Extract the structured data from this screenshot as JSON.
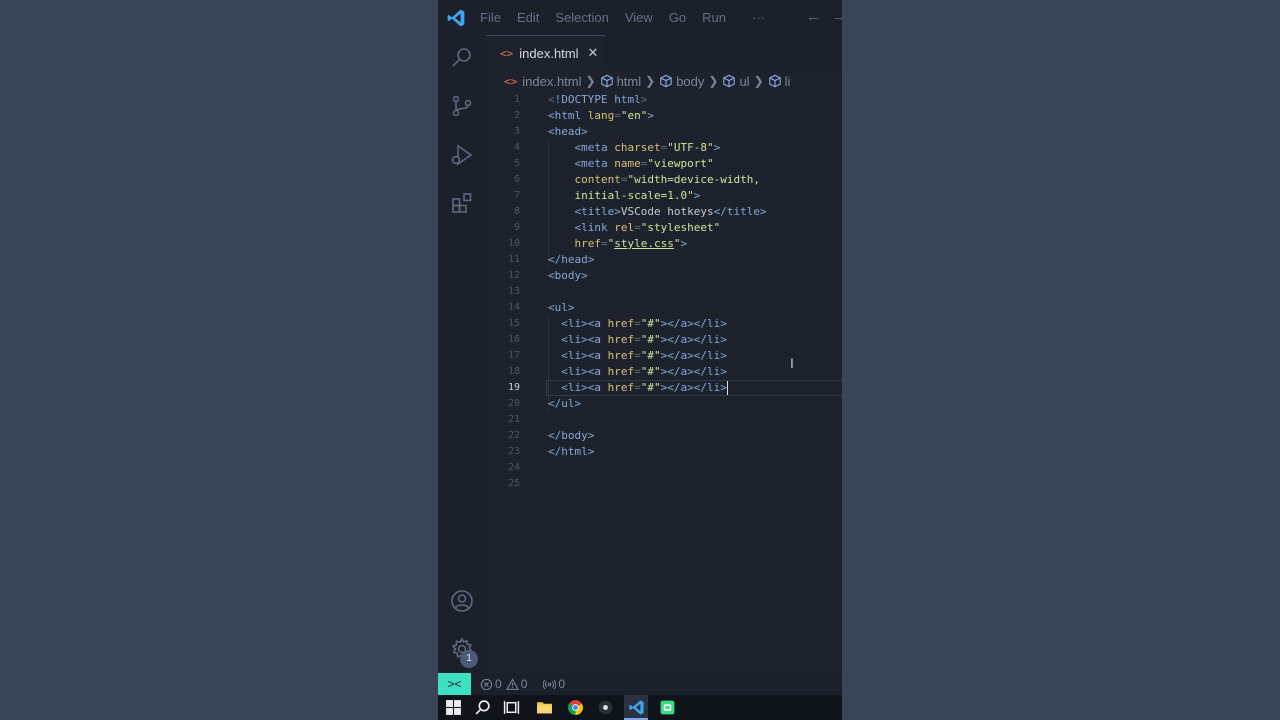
{
  "window": {
    "menu": [
      "File",
      "Edit",
      "Selection",
      "View",
      "Go",
      "Run"
    ],
    "menu_more": "···"
  },
  "tab": {
    "label": "index.html",
    "close": "✕"
  },
  "breadcrumb": [
    "index.html",
    "html",
    "body",
    "ul",
    "li"
  ],
  "editor": {
    "active_line": 19,
    "lines": [
      {
        "n": "1"
      },
      {
        "n": "2"
      },
      {
        "n": "3"
      },
      {
        "n": "4"
      },
      {
        "n": "5"
      },
      {
        "n": "6"
      },
      {
        "n": "7"
      },
      {
        "n": "8"
      },
      {
        "n": "9"
      },
      {
        "n": "10"
      },
      {
        "n": "11"
      },
      {
        "n": "12"
      },
      {
        "n": "13"
      },
      {
        "n": "14"
      },
      {
        "n": "15"
      },
      {
        "n": "16"
      },
      {
        "n": "17"
      },
      {
        "n": "18"
      },
      {
        "n": "19"
      },
      {
        "n": "20"
      },
      {
        "n": "21"
      },
      {
        "n": "22"
      },
      {
        "n": "23"
      },
      {
        "n": "24"
      },
      {
        "n": "25"
      }
    ],
    "code": {
      "doctype_kw": "!DOCTYPE html",
      "html_lang": "\"en\"",
      "charset": "\"UTF-8\"",
      "viewport": "\"viewport\"",
      "content_1": "\"width=device-width,",
      "content_2": "initial-scale=1.0\"",
      "title_text": "VSCode hotkeys",
      "rel": "\"stylesheet\"",
      "href_css": "style.css",
      "href_hash": "\"#\""
    }
  },
  "statusbar": {
    "errors": "0",
    "warnings": "0",
    "ports": "0"
  },
  "activity": {
    "settings_badge": "1"
  },
  "colors": {
    "accent": "#3ddfc1",
    "tag": "#83a8d8",
    "attribute": "#d5c27a",
    "string": "#cfe39c",
    "file_icon": "#e8734a"
  }
}
